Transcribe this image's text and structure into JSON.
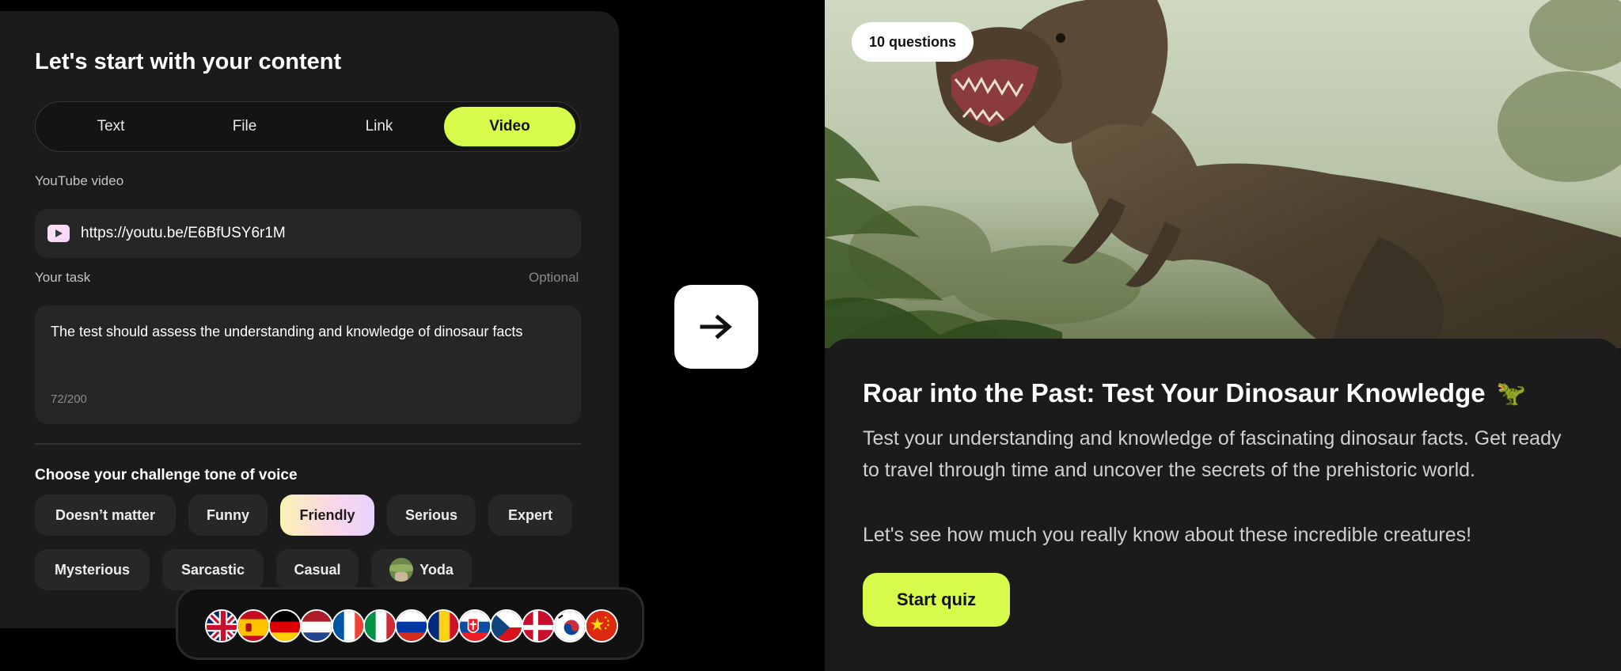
{
  "content_form": {
    "title": "Let's start with your content",
    "tabs": [
      {
        "label": "Text"
      },
      {
        "label": "File"
      },
      {
        "label": "Link"
      },
      {
        "label": "Video",
        "active": true
      }
    ],
    "youtube_label": "YouTube video",
    "youtube_url": "https://youtu.be/E6BfUSY6r1M",
    "task_label": "Your task",
    "task_optional": "Optional",
    "task_text": "The test should assess the understanding and knowledge of dinosaur facts",
    "task_count": "72/200",
    "tone_title": "Choose your challenge tone of voice",
    "tones": [
      {
        "label": "Doesn’t matter"
      },
      {
        "label": "Funny"
      },
      {
        "label": "Friendly",
        "selected": true
      },
      {
        "label": "Serious"
      },
      {
        "label": "Expert"
      },
      {
        "label": "Mysterious"
      },
      {
        "label": "Sarcastic"
      },
      {
        "label": "Casual"
      },
      {
        "label": "Yoda",
        "icon": "yoda-icon"
      }
    ],
    "languages": [
      "uk-flag",
      "spain-flag",
      "germany-flag",
      "netherlands-flag",
      "france-flag",
      "italy-flag",
      "russia-flag",
      "romania-flag",
      "slovakia-flag",
      "czech-flag",
      "denmark-flag",
      "korea-flag",
      "china-flag"
    ]
  },
  "arrow_icon": "arrow-right-icon",
  "quiz": {
    "question_count": "10 questions",
    "title": "Roar into the Past: Test Your Dinosaur Knowledge",
    "title_emoji": "🦖",
    "description": "Test your understanding and knowledge of fascinating dinosaur facts. Get ready to travel through time and uncover the secrets of the prehistoric world.",
    "description_2": "Let's see how much you really know about these incredible creatures!",
    "start_label": "Start quiz"
  },
  "colors": {
    "accent": "#d6fb4a",
    "panel": "#1b1b1b",
    "background": "#000000"
  }
}
